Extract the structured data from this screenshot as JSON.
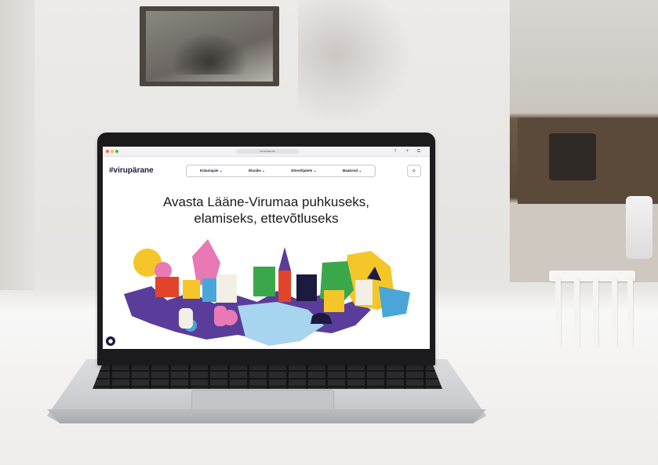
{
  "browser": {
    "url": "virumaa.ee",
    "traffic_lights": [
      "#ff5f57",
      "#febc2e",
      "#28c840"
    ]
  },
  "site": {
    "logo": "#virupärane",
    "nav": [
      {
        "label": "Külastajale ⌄"
      },
      {
        "label": "Elanike ⌄"
      },
      {
        "label": "Ettevõtjatele ⌄"
      },
      {
        "label": "Maakond ⌄"
      }
    ],
    "search_icon": "search-icon",
    "headline_line1": "Avasta Lääne-Virumaa puhkuseks,",
    "headline_line2": "elamiseks, ettevõtluseks",
    "chat_icon": "chat-icon"
  },
  "colors": {
    "brand_dark": "#1c1a3e",
    "illus_purple": "#5a3d9a",
    "illus_yellow": "#f5c629",
    "illus_pink": "#e879b4",
    "illus_blue": "#4aa6d9",
    "illus_green": "#3aa84a",
    "illus_red": "#e0452b",
    "illus_lightblue": "#a7d4ef"
  }
}
